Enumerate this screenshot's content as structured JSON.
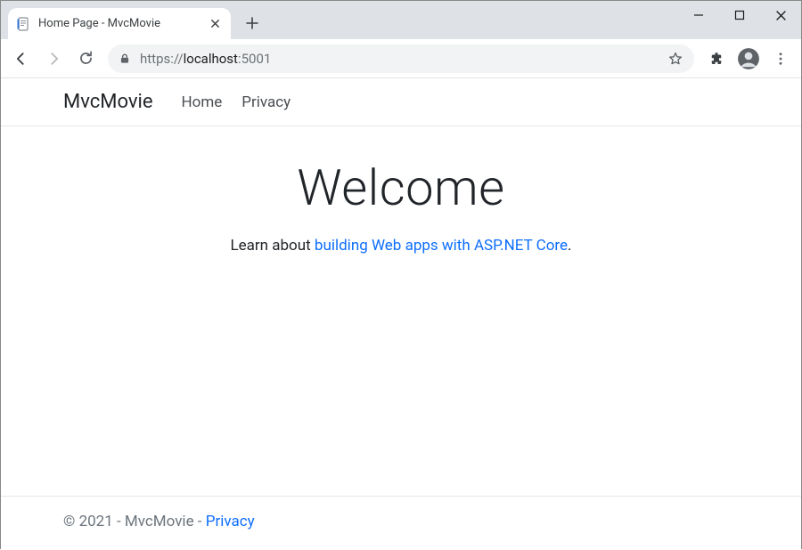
{
  "window": {
    "tab_title": "Home Page - MvcMovie"
  },
  "toolbar": {
    "url_scheme": "https://",
    "url_host": "localhost",
    "url_port": ":5001"
  },
  "navbar": {
    "brand": "MvcMovie",
    "links": [
      "Home",
      "Privacy"
    ]
  },
  "content": {
    "heading": "Welcome",
    "lead_prefix": "Learn about ",
    "lead_link": "building Web apps with ASP.NET Core",
    "lead_suffix": "."
  },
  "footer": {
    "text": "© 2021 - MvcMovie - ",
    "privacy": "Privacy"
  }
}
